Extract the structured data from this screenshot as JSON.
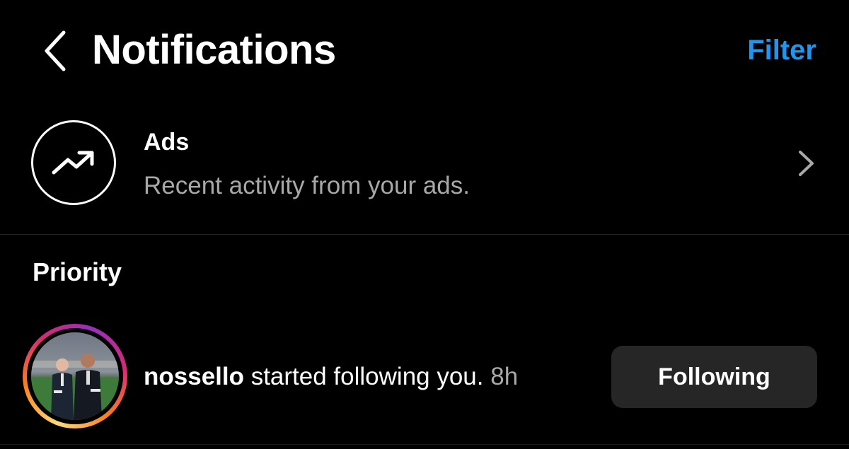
{
  "header": {
    "back_icon": "chevron-left-icon",
    "title": "Notifications",
    "filter_label": "Filter"
  },
  "ads": {
    "icon": "trending-up-icon",
    "title": "Ads",
    "subtitle": "Recent activity from your ads.",
    "chevron_icon": "chevron-right-icon"
  },
  "priority": {
    "section_title": "Priority",
    "notifications": [
      {
        "username": "nossello",
        "action": " started following you.",
        "time": "8h",
        "button_label": "Following"
      }
    ]
  },
  "colors": {
    "background": "#000000",
    "accent": "#1d96f1",
    "secondary_text": "#a8a8a8",
    "button_bg": "#262626"
  }
}
